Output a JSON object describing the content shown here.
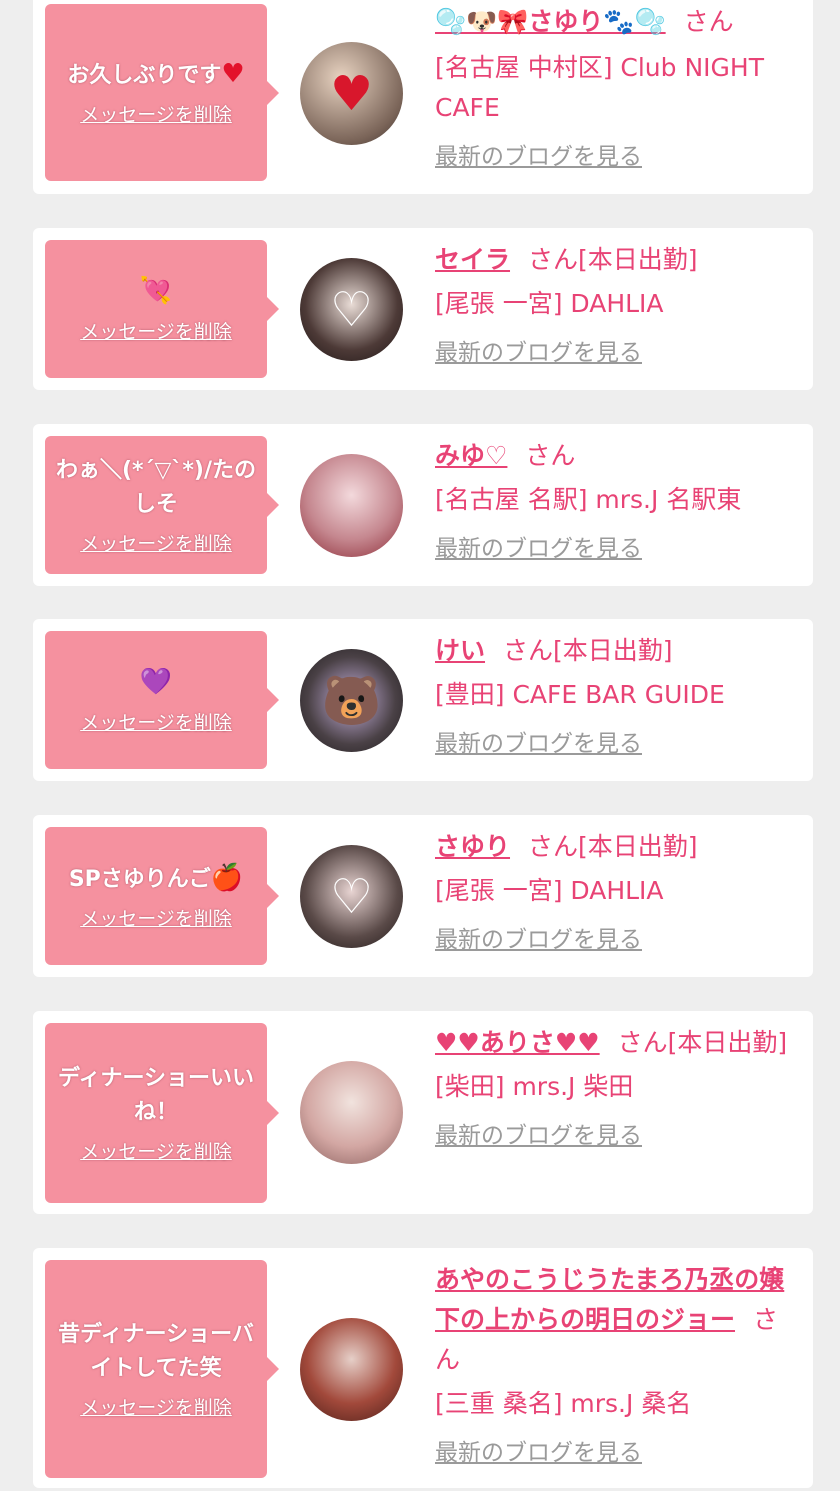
{
  "delete_label": "メッセージを削除",
  "blog_label": "最新のブログを見る",
  "san_suffix": "さん",
  "colors": {
    "accent": "#e84375",
    "bubble": "#f5919f",
    "link_gray": "#9a9a9a",
    "background": "#eeeeee"
  },
  "cards": [
    {
      "message": "お久しぶりです",
      "message_glyph": "♥",
      "name": "🫧🐶🎀さゆり🐾🫧",
      "status": "",
      "shop": "[名古屋 中村区] Club NIGHT CAFE",
      "avatar_overlay": "♥"
    },
    {
      "message": "",
      "message_glyph": "💘",
      "name": "セイラ",
      "status": "[本日出勤]",
      "shop": "[尾張 一宮] DAHLIA",
      "avatar_overlay": "♡"
    },
    {
      "message": "わぁ＼(*´▽`*)/たのしそ",
      "message_glyph": "",
      "name": "みゆ♡",
      "status": "",
      "shop": "[名古屋 名駅] mrs.J 名駅東",
      "avatar_overlay": ""
    },
    {
      "message": "",
      "message_glyph": "💜",
      "name": "けい",
      "status": "[本日出勤]",
      "shop": "[豊田] CAFE BAR GUIDE",
      "avatar_overlay": "🐻"
    },
    {
      "message": "SPさゆりんご",
      "message_glyph": "🍎",
      "name": "さゆり",
      "status": "[本日出勤]",
      "shop": "[尾張 一宮] DAHLIA",
      "avatar_overlay": "♡"
    },
    {
      "message": "ディナーショーいいね！",
      "message_glyph": "",
      "name": "♥♥ありさ♥♥",
      "status": "[本日出勤]",
      "shop": "[柴田] mrs.J 柴田",
      "avatar_overlay": ""
    },
    {
      "message": "昔ディナーショーバイトしてた笑",
      "message_glyph": "",
      "name": "あやのこうじうたまろ乃丞の嬢下の上からの明日のジョー",
      "status": "",
      "shop": "[三重 桑名] mrs.J 桑名",
      "avatar_overlay": ""
    }
  ]
}
